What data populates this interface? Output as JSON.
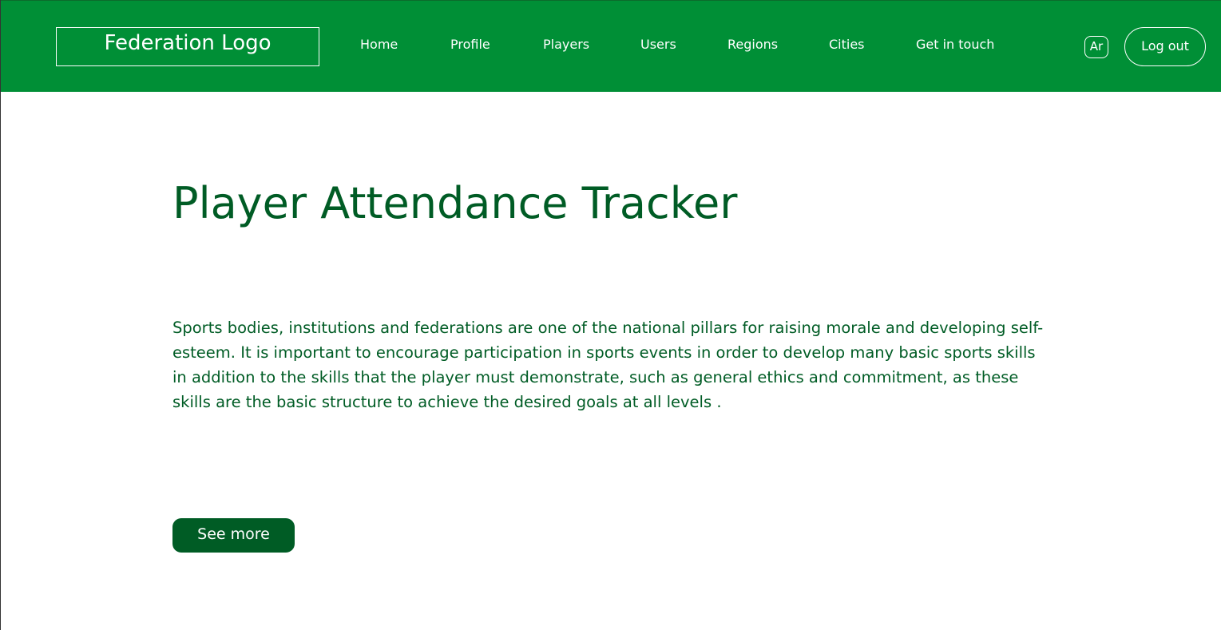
{
  "header": {
    "logo_text": "Federation Logo",
    "nav": [
      {
        "label": "Home"
      },
      {
        "label": "Profile"
      },
      {
        "label": "Players"
      },
      {
        "label": "Users"
      },
      {
        "label": "Regions"
      },
      {
        "label": "Cities"
      },
      {
        "label": "Get in touch"
      }
    ],
    "language_toggle": "Ar",
    "logout_label": "Log out"
  },
  "hero": {
    "title": "Player Attendance Tracker",
    "description": "Sports bodies, institutions and federations are one of the national pillars for raising morale and developing self-esteem. It is important to encourage participation in sports events in order to develop many basic sports skills in addition to the skills that the player must demonstrate, such as general ethics and commitment, as these skills are the basic structure to achieve the desired goals at all levels .",
    "cta_label": "See more"
  },
  "colors": {
    "navbar": "#008f36",
    "primary_text": "#005c25",
    "button": "#005c25"
  }
}
